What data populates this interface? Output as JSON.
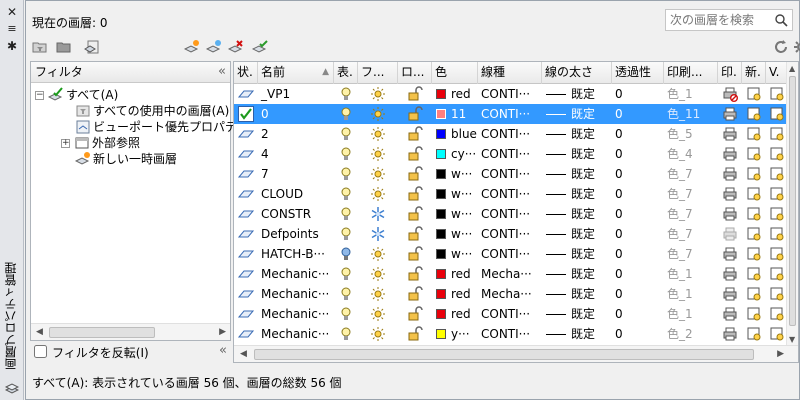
{
  "palette": {
    "title": "画層プロパティ管理",
    "close_glyph": "✕",
    "pin_glyph": "✱",
    "settings_glyph": "✲"
  },
  "current_layer": "現在の画層: 0",
  "search": {
    "placeholder": "次の画層を検索"
  },
  "toolbar_icons": [
    "new-filter-icon",
    "new-group-filter-icon",
    "layer-states-icon",
    "new-layer-icon",
    "new-layer-vp-frozen-icon",
    "delete-layer-icon",
    "set-current-icon",
    "refresh-icon",
    "settings-icon"
  ],
  "filter": {
    "header": "フィルタ",
    "collapse_glyph": "«",
    "tree": [
      {
        "label": "すべて(A)",
        "expander": "−"
      },
      {
        "label": "すべての使用中の画層(A)"
      },
      {
        "label": "ビューポート優先プロパティ"
      },
      {
        "label": "外部参照",
        "expander": "+"
      },
      {
        "label": "新しい一時画層"
      }
    ],
    "invert_label": "フィルタを反転(I)",
    "invert_checked": false
  },
  "grid": {
    "columns": [
      "状.",
      "名前",
      "表.",
      "フ...",
      "ロ...",
      "色",
      "線種",
      "線の太さ",
      "透過性",
      "印刷...",
      "印.",
      "新.",
      "V."
    ],
    "rows": [
      {
        "name": "_VP1",
        "color_name": "red",
        "color": "#e8000b",
        "linetype": "CONTI···",
        "lineweight": "既定",
        "transparency": "0",
        "plot_style": "色_1",
        "on": true,
        "frozen": false,
        "locked": false,
        "plot": "no-plot",
        "selected": false
      },
      {
        "name": "0",
        "color_name": "11",
        "color": "#ff7f7f",
        "linetype": "CONTI···",
        "lineweight": "既定",
        "transparency": "0",
        "plot_style": "色_11",
        "on": true,
        "frozen": false,
        "locked": false,
        "plot": "plot",
        "selected": true
      },
      {
        "name": "2",
        "color_name": "blue",
        "color": "#0000ff",
        "linetype": "CONTI···",
        "lineweight": "既定",
        "transparency": "0",
        "plot_style": "色_5",
        "on": true,
        "frozen": false,
        "locked": false,
        "plot": "plot",
        "selected": false
      },
      {
        "name": "4",
        "color_name": "cy···",
        "color": "#00ffff",
        "linetype": "CONTI···",
        "lineweight": "既定",
        "transparency": "0",
        "plot_style": "色_4",
        "on": true,
        "frozen": false,
        "locked": false,
        "plot": "plot",
        "selected": false
      },
      {
        "name": "7",
        "color_name": "w···",
        "color": "#000000",
        "linetype": "CONTI···",
        "lineweight": "既定",
        "transparency": "0",
        "plot_style": "色_7",
        "on": true,
        "frozen": false,
        "locked": false,
        "plot": "plot",
        "selected": false
      },
      {
        "name": "CLOUD",
        "color_name": "w···",
        "color": "#000000",
        "linetype": "CONTI···",
        "lineweight": "既定",
        "transparency": "0",
        "plot_style": "色_7",
        "on": true,
        "frozen": false,
        "locked": false,
        "plot": "plot",
        "selected": false
      },
      {
        "name": "CONSTR",
        "color_name": "w···",
        "color": "#000000",
        "linetype": "CONTI···",
        "lineweight": "既定",
        "transparency": "0",
        "plot_style": "色_7",
        "on": true,
        "frozen": true,
        "locked": false,
        "plot": "plot",
        "selected": false
      },
      {
        "name": "Defpoints",
        "color_name": "w···",
        "color": "#000000",
        "linetype": "CONTI···",
        "lineweight": "既定",
        "transparency": "0",
        "plot_style": "色_7",
        "on": true,
        "frozen": true,
        "locked": false,
        "plot": "no-plot-grey",
        "selected": false
      },
      {
        "name": "HATCH-B···",
        "color_name": "w···",
        "color": "#000000",
        "linetype": "CONTI···",
        "lineweight": "既定",
        "transparency": "0",
        "plot_style": "色_7",
        "on": false,
        "frozen": false,
        "locked": false,
        "plot": "plot",
        "selected": false
      },
      {
        "name": "Mechanic···",
        "color_name": "red",
        "color": "#e8000b",
        "linetype": "Mecha···",
        "lineweight": "既定",
        "transparency": "0",
        "plot_style": "色_1",
        "on": true,
        "frozen": false,
        "locked": false,
        "plot": "plot",
        "selected": false
      },
      {
        "name": "Mechanic···",
        "color_name": "red",
        "color": "#e8000b",
        "linetype": "Mecha···",
        "lineweight": "既定",
        "transparency": "0",
        "plot_style": "色_1",
        "on": true,
        "frozen": false,
        "locked": false,
        "plot": "plot",
        "selected": false
      },
      {
        "name": "Mechanic···",
        "color_name": "red",
        "color": "#e8000b",
        "linetype": "CONTI···",
        "lineweight": "既定",
        "transparency": "0",
        "plot_style": "色_1",
        "on": true,
        "frozen": false,
        "locked": false,
        "plot": "plot",
        "selected": false
      },
      {
        "name": "Mechanic···",
        "color_name": "y···",
        "color": "#ffff00",
        "linetype": "CONTI···",
        "lineweight": "既定",
        "transparency": "0",
        "plot_style": "色_2",
        "on": true,
        "frozen": false,
        "locked": false,
        "plot": "plot",
        "selected": false
      }
    ]
  },
  "status": "すべて(A): 表示されている画層 56 個、画層の総数 56 個"
}
